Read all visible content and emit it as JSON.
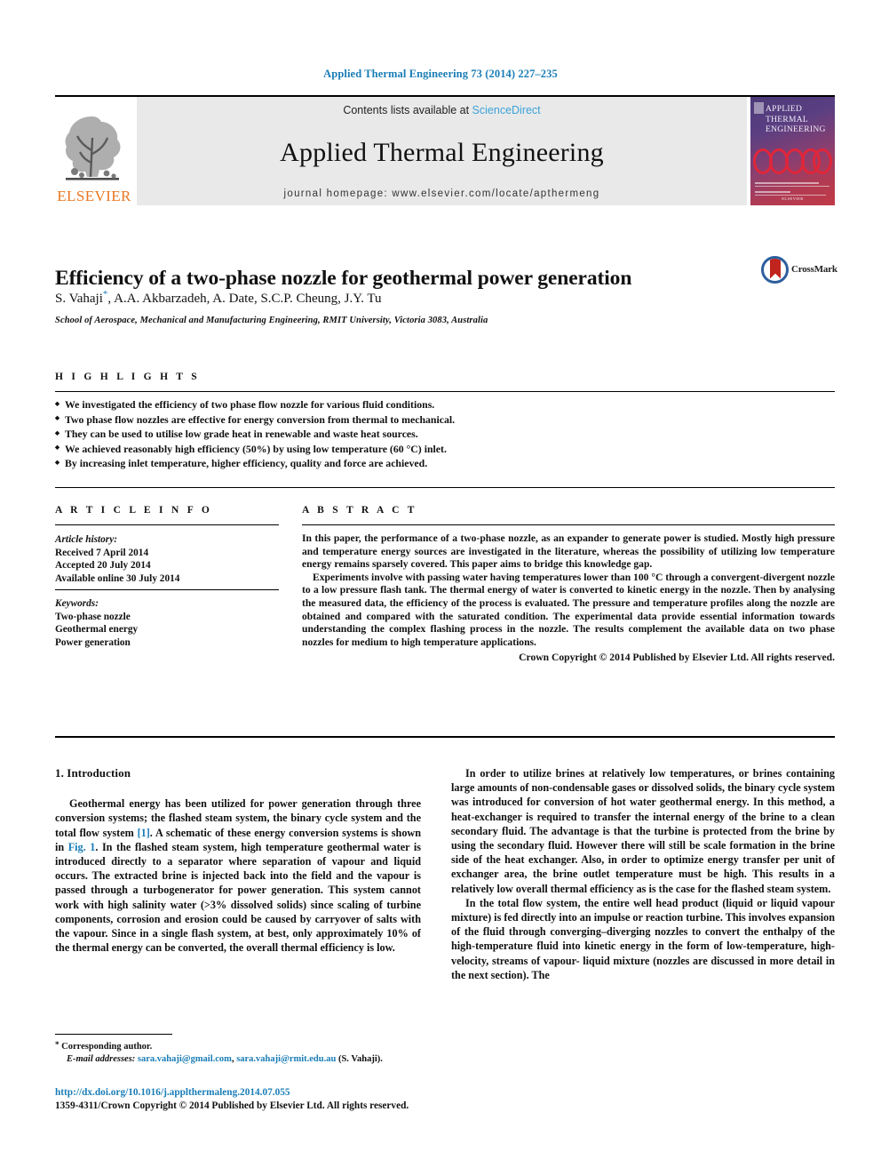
{
  "running_head": "Applied Thermal Engineering 73 (2014) 227–235",
  "masthead": {
    "publisher_logo_text": "ELSEVIER",
    "contents_prefix": "Contents lists available at ",
    "contents_link": "ScienceDirect",
    "journal_name": "Applied Thermal Engineering",
    "homepage": "journal homepage: www.elsevier.com/locate/apthermeng",
    "cover_title": "APPLIED\nTHERMAL\nENGINEERING",
    "cover_line1": "APPLIED",
    "cover_line2": "THERMAL",
    "cover_line3": "ENGINEERING",
    "cover_footer": "ELSEVIER"
  },
  "article": {
    "title": "Efficiency of a two-phase nozzle for geothermal power generation",
    "authors_html": "S. Vahaji<sup>*</sup>, A.A. Akbarzadeh, A. Date, S.C.P. Cheung, J.Y. Tu",
    "affiliation": "School of Aerospace, Mechanical and Manufacturing Engineering, RMIT University, Victoria 3083, Australia",
    "crossmark_label": "CrossMark"
  },
  "highlights": {
    "label": "H I G H L I G H T S",
    "items": [
      "We investigated the efficiency of two phase flow nozzle for various fluid conditions.",
      "Two phase flow nozzles are effective for energy conversion from thermal to mechanical.",
      "They can be used to utilise low grade heat in renewable and waste heat sources.",
      "We achieved reasonably high efficiency (50%) by using low temperature (60 °C) inlet.",
      "By increasing inlet temperature, higher efficiency, quality and force are achieved."
    ]
  },
  "article_info": {
    "label": "A R T I C L E   I N F O",
    "history_label": "Article history:",
    "history": [
      "Received 7 April 2014",
      "Accepted 20 July 2014",
      "Available online 30 July 2014"
    ],
    "keywords_label": "Keywords:",
    "keywords": [
      "Two-phase nozzle",
      "Geothermal energy",
      "Power generation"
    ]
  },
  "abstract": {
    "label": "A B S T R A C T",
    "paragraph1": "In this paper, the performance of a two-phase nozzle, as an expander to generate power is studied. Mostly high pressure and temperature energy sources are investigated in the literature, whereas the possibility of utilizing low temperature energy remains sparsely covered. This paper aims to bridge this knowledge gap.",
    "paragraph2": "Experiments involve with passing water having temperatures lower than 100 °C through a convergent-divergent nozzle to a low pressure flash tank. The thermal energy of water is converted to kinetic energy in the nozzle. Then by analysing the measured data, the efficiency of the process is evaluated. The pressure and temperature profiles along the nozzle are obtained and compared with the saturated condition. The experimental data provide essential information towards understanding the complex flashing process in the nozzle. The results complement the available data on two phase nozzles for medium to high temperature applications.",
    "copyright": "Crown Copyright © 2014 Published by Elsevier Ltd. All rights reserved."
  },
  "body": {
    "section_heading": "1. Introduction",
    "left_para1_a": "Geothermal energy has been utilized for power generation through three conversion systems; the flashed steam system, the binary cycle system and the total flow system ",
    "left_ref1": "[1]",
    "left_para1_b": ". A schematic of these energy conversion systems is shown in ",
    "left_ref2": "Fig. 1",
    "left_para1_c": ". In the flashed steam system, high temperature geothermal water is introduced directly to a separator where separation of vapour and liquid occurs. The extracted brine is injected back into the field and the vapour is passed through a turbogenerator for power generation. This system cannot work with high salinity water (>3% dissolved solids) since scaling of turbine components, corrosion and erosion could be caused by carryover of salts with the vapour. Since in a single flash system, at best, only approximately 10% of the thermal energy can be converted, the overall thermal efficiency is low.",
    "right_para1": "In order to utilize brines at relatively low temperatures, or brines containing large amounts of non-condensable gases or dissolved solids, the binary cycle system was introduced for conversion of hot water geothermal energy. In this method, a heat-exchanger is required to transfer the internal energy of the brine to a clean secondary fluid. The advantage is that the turbine is protected from the brine by using the secondary fluid. However there will still be scale formation in the brine side of the heat exchanger. Also, in order to optimize energy transfer per unit of exchanger area, the brine outlet temperature must be high. This results in a relatively low overall thermal efficiency as is the case for the flashed steam system.",
    "right_para2": "In the total flow system, the entire well head product (liquid or liquid vapour mixture) is fed directly into an impulse or reaction turbine. This involves expansion of the fluid through converging–diverging nozzles to convert the enthalpy of the high-temperature fluid into kinetic energy in the form of low-temperature, high-velocity, streams of vapour- liquid mixture (nozzles are discussed in more detail in the next section). The"
  },
  "footer": {
    "corresponding_marker": "*",
    "corresponding_label": "Corresponding author.",
    "email_label": "E-mail addresses:",
    "email1": "sara.vahaji@gmail.com",
    "email_sep": ", ",
    "email2": "sara.vahaji@rmit.edu.au",
    "email_suffix": " (S. Vahaji).",
    "doi": "http://dx.doi.org/10.1016/j.applthermaleng.2014.07.055",
    "issn_line": "1359-4311/Crown Copyright © 2014 Published by Elsevier Ltd. All rights reserved."
  },
  "colors": {
    "link": "#1a7db6",
    "sciencedirect": "#3aa3d9",
    "elsevier_orange": "#E87722",
    "masthead_bg": "#e9e9e9",
    "crossmark_blue": "#2c5f9e",
    "crossmark_red": "#c0241c"
  }
}
